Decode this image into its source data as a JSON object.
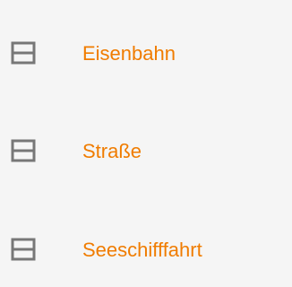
{
  "colors": {
    "background": "#f5f5f5",
    "label": "#f07c00",
    "icon": "#777777"
  },
  "transport_modes": [
    {
      "label": "Eisenbahn",
      "icon": "view-split-horizontal-icon"
    },
    {
      "label": "Straße",
      "icon": "view-split-horizontal-icon"
    },
    {
      "label": "Seeschifffahrt",
      "icon": "view-split-horizontal-icon"
    }
  ]
}
